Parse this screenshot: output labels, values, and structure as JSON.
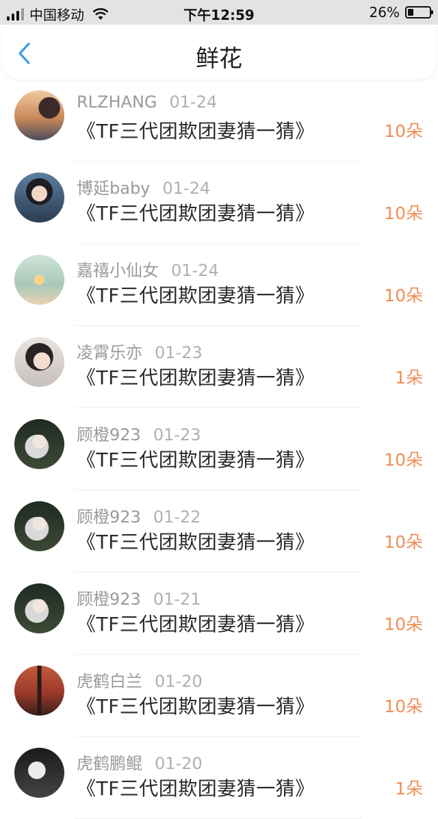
{
  "status_bar": {
    "carrier": "中国移动",
    "time": "下午12:59",
    "battery_percent": "26%",
    "battery_level": 0.26
  },
  "nav": {
    "title": "鲜花",
    "back_icon": "chevron-left-icon",
    "accent_color": "#3a9be6"
  },
  "colors": {
    "amount": "#ef8f57"
  },
  "gifts": [
    {
      "user": "RLZHANG",
      "date": "01-24",
      "title": "《TF三代团欺团妻猜一猜》",
      "amount": "10朵"
    },
    {
      "user": "博延baby",
      "date": "01-24",
      "title": "《TF三代团欺团妻猜一猜》",
      "amount": "10朵"
    },
    {
      "user": "嘉禧小仙女",
      "date": "01-24",
      "title": "《TF三代团欺团妻猜一猜》",
      "amount": "10朵"
    },
    {
      "user": "凌霄乐亦",
      "date": "01-23",
      "title": "《TF三代团欺团妻猜一猜》",
      "amount": "1朵"
    },
    {
      "user": "顾橙923",
      "date": "01-23",
      "title": "《TF三代团欺团妻猜一猜》",
      "amount": "10朵"
    },
    {
      "user": "顾橙923",
      "date": "01-22",
      "title": "《TF三代团欺团妻猜一猜》",
      "amount": "10朵"
    },
    {
      "user": "顾橙923",
      "date": "01-21",
      "title": "《TF三代团欺团妻猜一猜》",
      "amount": "10朵"
    },
    {
      "user": "虎鹤白兰",
      "date": "01-20",
      "title": "《TF三代团欺团妻猜一猜》",
      "amount": "10朵"
    },
    {
      "user": "虎鹤鹏鲲",
      "date": "01-20",
      "title": "《TF三代团欺团妻猜一猜》",
      "amount": "1朵"
    }
  ]
}
